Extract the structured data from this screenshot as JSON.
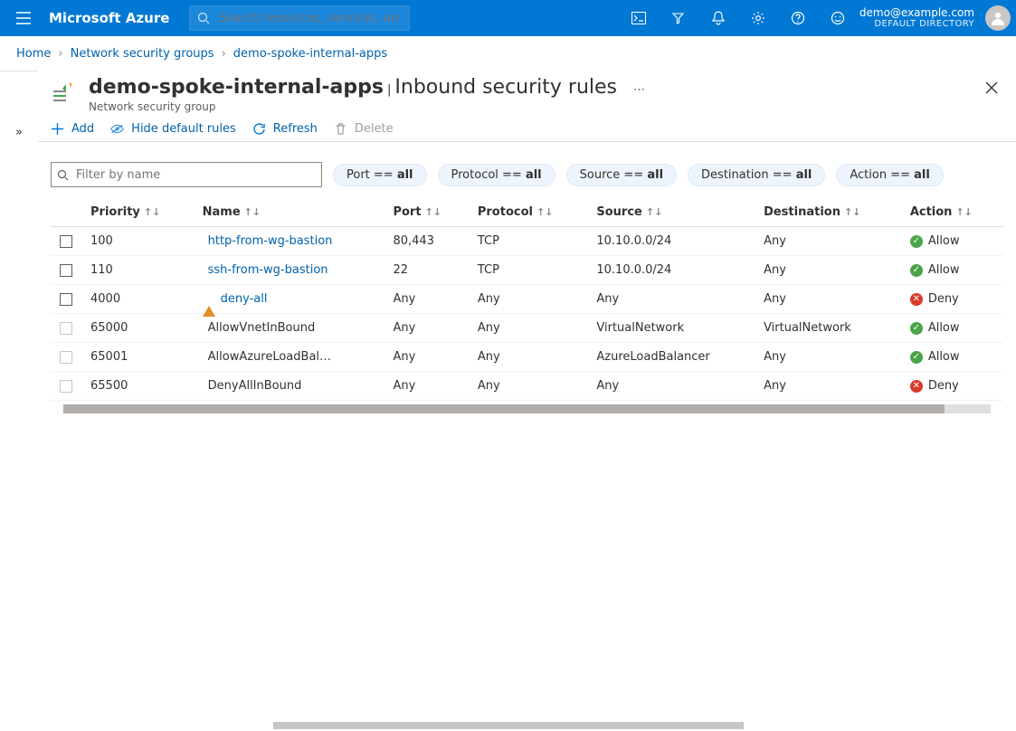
{
  "header": {
    "brand": "Microsoft Azure",
    "search_placeholder": "Search resources, services, and docs (G+/)",
    "account_email": "demo@example.com",
    "account_dir": "DEFAULT DIRECTORY"
  },
  "breadcrumb": {
    "home": "Home",
    "nsg": "Network security groups",
    "resource": "demo-spoke-internal-apps"
  },
  "page": {
    "resource_name": "demo-spoke-internal-apps",
    "section": "Inbound security rules",
    "resource_type": "Network security group"
  },
  "commands": {
    "add": "Add",
    "hide": "Hide default rules",
    "refresh": "Refresh",
    "delete": "Delete"
  },
  "filter": {
    "placeholder": "Filter by name",
    "chips": [
      {
        "label": "Port ==",
        "value": "all"
      },
      {
        "label": "Protocol ==",
        "value": "all"
      },
      {
        "label": "Source ==",
        "value": "all"
      },
      {
        "label": "Destination ==",
        "value": "all"
      },
      {
        "label": "Action ==",
        "value": "all"
      }
    ]
  },
  "columns": {
    "priority": "Priority",
    "name": "Name",
    "port": "Port",
    "protocol": "Protocol",
    "source": "Source",
    "destination": "Destination",
    "action": "Action"
  },
  "rules": [
    {
      "priority": "100",
      "name": "http-from-wg-bastion",
      "port": "80,443",
      "protocol": "TCP",
      "source": "10.10.0.0/24",
      "destination": "Any",
      "action": "Allow",
      "is_default": false,
      "warn": false
    },
    {
      "priority": "110",
      "name": "ssh-from-wg-bastion",
      "port": "22",
      "protocol": "TCP",
      "source": "10.10.0.0/24",
      "destination": "Any",
      "action": "Allow",
      "is_default": false,
      "warn": false
    },
    {
      "priority": "4000",
      "name": "deny-all",
      "port": "Any",
      "protocol": "Any",
      "source": "Any",
      "destination": "Any",
      "action": "Deny",
      "is_default": false,
      "warn": true
    },
    {
      "priority": "65000",
      "name": "AllowVnetInBound",
      "port": "Any",
      "protocol": "Any",
      "source": "VirtualNetwork",
      "destination": "VirtualNetwork",
      "action": "Allow",
      "is_default": true,
      "warn": false
    },
    {
      "priority": "65001",
      "name": "AllowAzureLoadBalancerInBound",
      "port": "Any",
      "protocol": "Any",
      "source": "AzureLoadBalancer",
      "destination": "Any",
      "action": "Allow",
      "is_default": true,
      "warn": false
    },
    {
      "priority": "65500",
      "name": "DenyAllInBound",
      "port": "Any",
      "protocol": "Any",
      "source": "Any",
      "destination": "Any",
      "action": "Deny",
      "is_default": true,
      "warn": false
    }
  ]
}
